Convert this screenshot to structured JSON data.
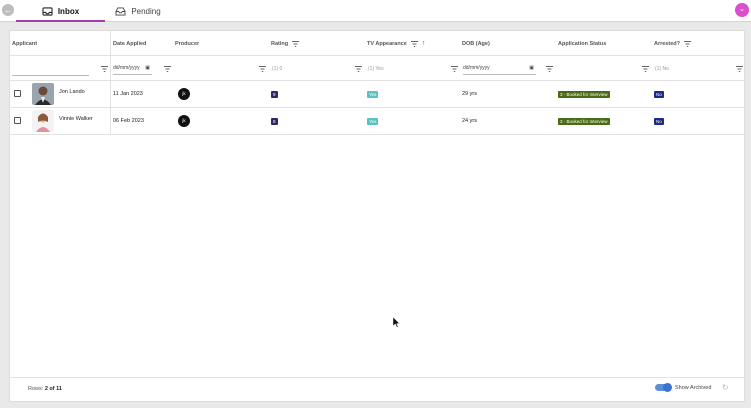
{
  "tabs": [
    {
      "label": "Inbox",
      "icon": "inbox-icon",
      "active": true
    },
    {
      "label": "Pending",
      "icon": "tray-icon",
      "active": false
    }
  ],
  "columns": {
    "applicant": "Applicant",
    "date_applied": "Date Applied",
    "producer": "Producer",
    "rating": "Rating",
    "tv_appearance": "TV Appearance",
    "dob": "DOB (Age)",
    "status": "Application Status",
    "arrested": "Arrested?"
  },
  "filters": {
    "date_placeholder": "dd/mm/yyyy",
    "rating": "(1) 0",
    "tv_appearance": "(1) Yes",
    "dob_placeholder": "dd/mm/yyyy",
    "arrested": "(1) No"
  },
  "rows": [
    {
      "name": "Jon Lando",
      "date_applied": "11 Jan 2023",
      "producer": "jk",
      "rating": "9",
      "tv_appearance": "Yes",
      "age": "29 yrs",
      "status": "3 - Booked for Interview",
      "arrested": "No"
    },
    {
      "name": "Vinnie Walker",
      "date_applied": "06 Feb 2023",
      "producer": "jk",
      "rating": "8",
      "tv_appearance": "Yes",
      "age": "24 yrs",
      "status": "3 - Booked for Interview",
      "arrested": "No"
    }
  ],
  "footer": {
    "rows_label": "Rows:",
    "rows_value": "2 of 11",
    "show_archived": "Show Archived"
  },
  "colors": {
    "accent": "#a43ca5",
    "rating_badge": "#2d2a66",
    "yes_badge": "#5ac2c0",
    "status_badge": "#4a6b16",
    "no_badge": "#1d2a8c",
    "toggle": "#3a74cf"
  }
}
